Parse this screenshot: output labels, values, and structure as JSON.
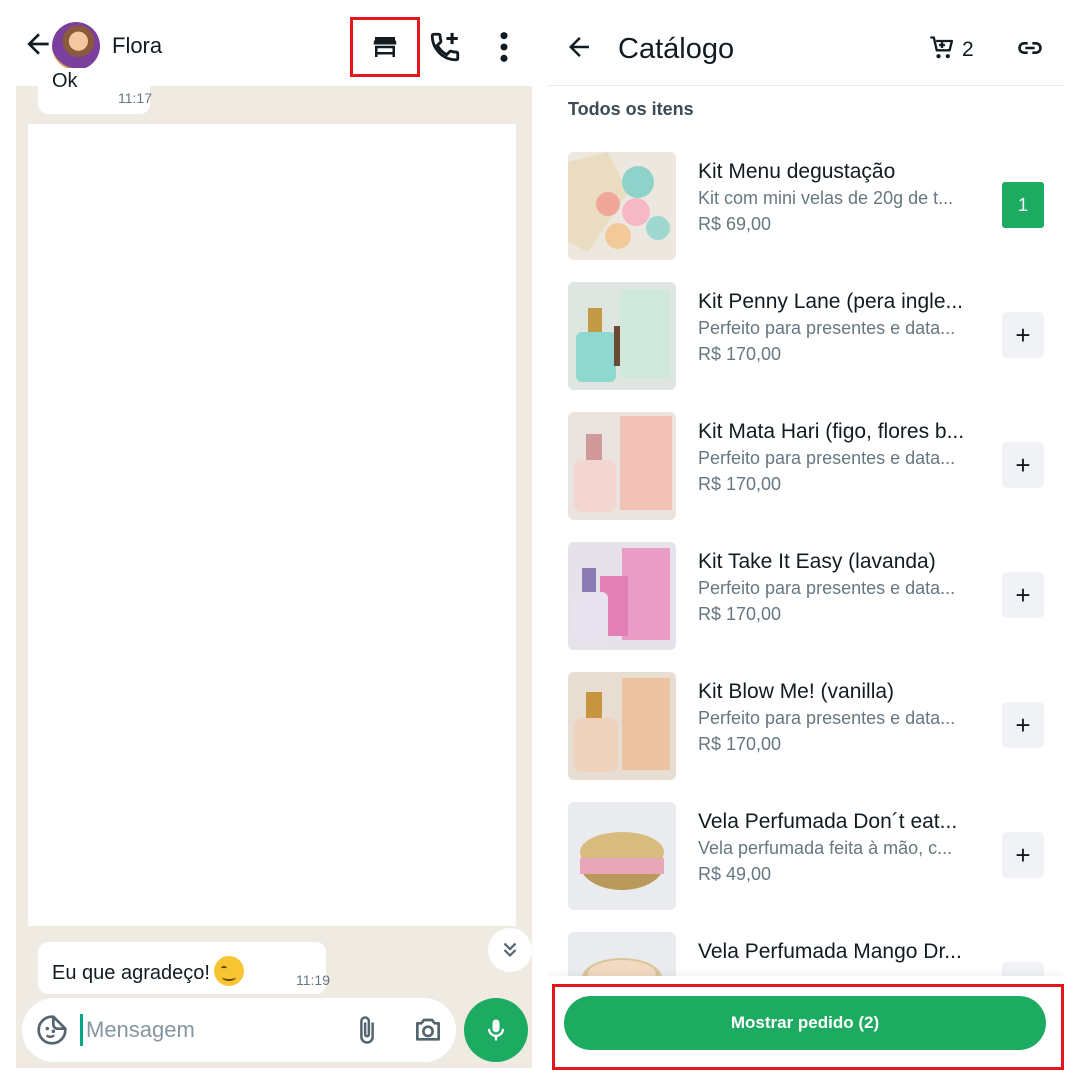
{
  "chat": {
    "contact_name": "Flora",
    "messages": [
      {
        "text": "Ok",
        "time": "11:17"
      },
      {
        "text": "Eu que agradeço!",
        "time": "11:19",
        "emoji": "smirk-smiley"
      }
    ],
    "composer": {
      "placeholder": "Mensagem"
    },
    "icons": [
      "back-arrow-icon",
      "catalog-store-icon",
      "add-call-icon",
      "more-vert-icon",
      "sticker-icon",
      "attach-icon",
      "camera-icon",
      "mic-icon",
      "double-chevron-down-icon"
    ]
  },
  "catalog": {
    "title": "Catálogo",
    "cart_count": "2",
    "section_label": "Todos os itens",
    "items": [
      {
        "name": "Kit Menu degustação",
        "desc": "Kit com mini velas de 20g de t...",
        "price": "R$ 69,00",
        "qty": "1",
        "in_cart": true,
        "thumb": "#d8c9b0"
      },
      {
        "name": "Kit Penny Lane (pera ingle...",
        "desc": "Perfeito para presentes e data...",
        "price": "R$ 170,00",
        "add": "+",
        "in_cart": false,
        "thumb": "#bfe0d3"
      },
      {
        "name": "Kit Mata Hari (figo, flores b...",
        "desc": "Perfeito para presentes e data...",
        "price": "R$ 170,00",
        "add": "+",
        "in_cart": false,
        "thumb": "#f1c9bd"
      },
      {
        "name": "Kit Take It Easy (lavanda)",
        "desc": "Perfeito para presentes e data...",
        "price": "R$ 170,00",
        "add": "+",
        "in_cart": false,
        "thumb": "#e9a3c8"
      },
      {
        "name": "Kit Blow Me! (vanilla)",
        "desc": "Perfeito para presentes e data...",
        "price": "R$ 170,00",
        "add": "+",
        "in_cart": false,
        "thumb": "#e6c4a6"
      },
      {
        "name": "Vela Perfumada  Don´t eat...",
        "desc": "Vela perfumada feita à mão, c...",
        "price": "R$ 49,00",
        "add": "+",
        "in_cart": false,
        "thumb": "#c9a86a"
      },
      {
        "name": "Vela Perfumada Mango Dr...",
        "desc": "",
        "price": "",
        "add": "+",
        "in_cart": false,
        "thumb": "#d9c59a"
      }
    ],
    "order_button": "Mostrar pedido (2)"
  },
  "colors": {
    "accent_green": "#1daa61",
    "highlight_red": "#e5161b",
    "chat_bg": "#efeae2"
  }
}
